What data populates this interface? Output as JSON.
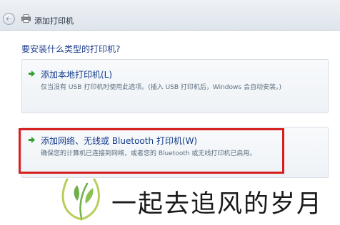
{
  "window": {
    "title": "添加打印机",
    "icons": {
      "back": "back-arrow-icon",
      "app": "printer-icon"
    }
  },
  "main": {
    "question": "要安装什么类型的打印机?",
    "options": [
      {
        "title": "添加本地打印机(L)",
        "description": "仅当没有 USB 打印机时使用此选项。(插入 USB 打印机后，Windows 会自动安装。)",
        "icon": "green-arrow-icon"
      },
      {
        "title": "添加网络、无线或 Bluetooth 打印机(W)",
        "description": "确保您的计算机已连接到网络，或者您的 Bluetooth 或无线打印机已启用。",
        "icon": "green-arrow-icon",
        "highlighted": true
      }
    ]
  },
  "watermark": {
    "text": "一起去追风的岁月",
    "logo": "leaf-logo"
  },
  "colors": {
    "highlight": "#d62020",
    "accent_text": "#123a8a",
    "arrow": "#2e9e2e"
  }
}
